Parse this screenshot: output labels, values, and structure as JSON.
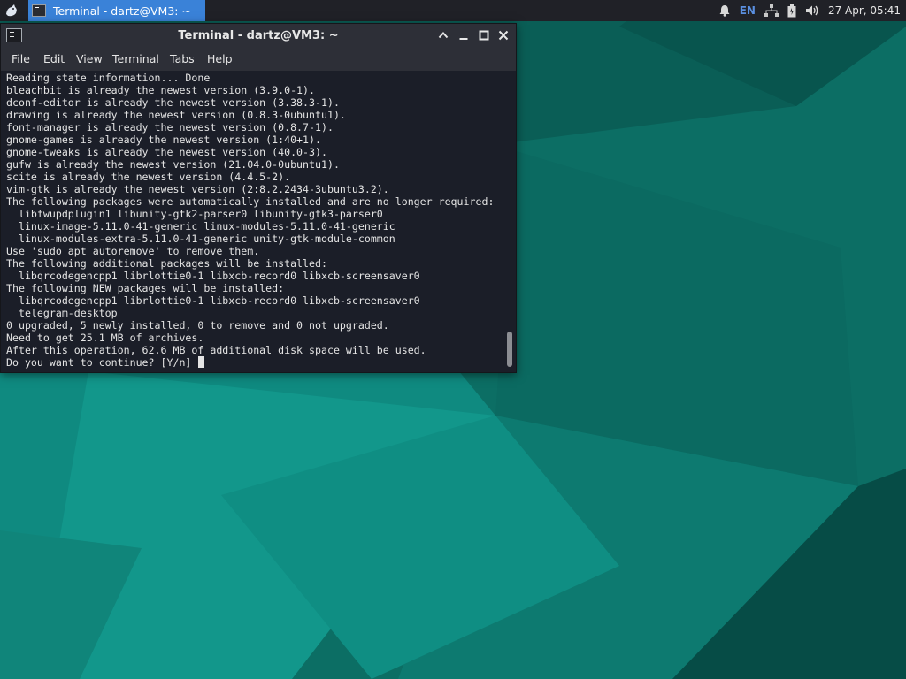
{
  "panel": {
    "task_title": "Terminal - dartz@VM3: ~",
    "keyboard_layout": "EN",
    "clock": "27 Apr, 05:41"
  },
  "window": {
    "title": "Terminal - dartz@VM3: ~",
    "menu": [
      "File",
      "Edit",
      "View",
      "Terminal",
      "Tabs",
      "Help"
    ]
  },
  "terminal": {
    "lines": [
      "Reading state information... Done",
      "bleachbit is already the newest version (3.9.0-1).",
      "dconf-editor is already the newest version (3.38.3-1).",
      "drawing is already the newest version (0.8.3-0ubuntu1).",
      "font-manager is already the newest version (0.8.7-1).",
      "gnome-games is already the newest version (1:40+1).",
      "gnome-tweaks is already the newest version (40.0-3).",
      "gufw is already the newest version (21.04.0-0ubuntu1).",
      "scite is already the newest version (4.4.5-2).",
      "vim-gtk is already the newest version (2:8.2.2434-3ubuntu3.2).",
      "The following packages were automatically installed and are no longer required:",
      "  libfwupdplugin1 libunity-gtk2-parser0 libunity-gtk3-parser0",
      "  linux-image-5.11.0-41-generic linux-modules-5.11.0-41-generic",
      "  linux-modules-extra-5.11.0-41-generic unity-gtk-module-common",
      "Use 'sudo apt autoremove' to remove them.",
      "The following additional packages will be installed:",
      "  libqrcodegencpp1 librlottie0-1 libxcb-record0 libxcb-screensaver0",
      "The following NEW packages will be installed:",
      "  libqrcodegencpp1 librlottie0-1 libxcb-record0 libxcb-screensaver0",
      "  telegram-desktop",
      "0 upgraded, 5 newly installed, 0 to remove and 0 not upgraded.",
      "Need to get 25.1 MB of archives.",
      "After this operation, 62.6 MB of additional disk space will be used."
    ],
    "prompt": "Do you want to continue? [Y/n] "
  },
  "colors": {
    "panel_bg": "#202127",
    "task_active_bg": "#3a82d8",
    "window_bg": "#2d2f37",
    "terminal_bg": "#1b1e28",
    "terminal_fg": "#e4e4e4",
    "wallpaper_base": "#0b5f57"
  }
}
